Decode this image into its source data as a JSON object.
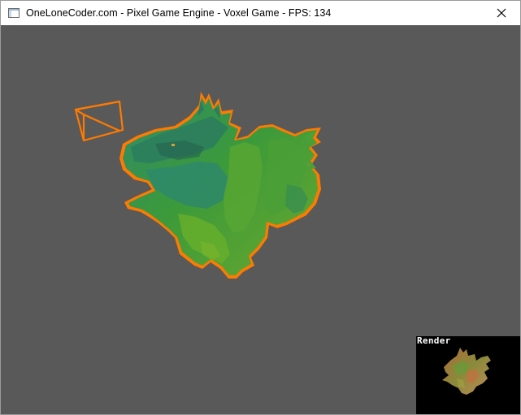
{
  "window": {
    "title": "OneLoneCoder.com - Pixel Game Engine - Voxel Game - FPS: 134",
    "icon": "app-window-icon",
    "close_icon": "close-icon"
  },
  "viewport": {
    "background_color": "#595959",
    "model": "voxel-dragon",
    "model_color": "#3f9a3a",
    "outline_color": "#ff7a00",
    "camera_icon": "camera-frustum-icon"
  },
  "render_panel": {
    "label": "Render",
    "background_color": "#000000"
  }
}
